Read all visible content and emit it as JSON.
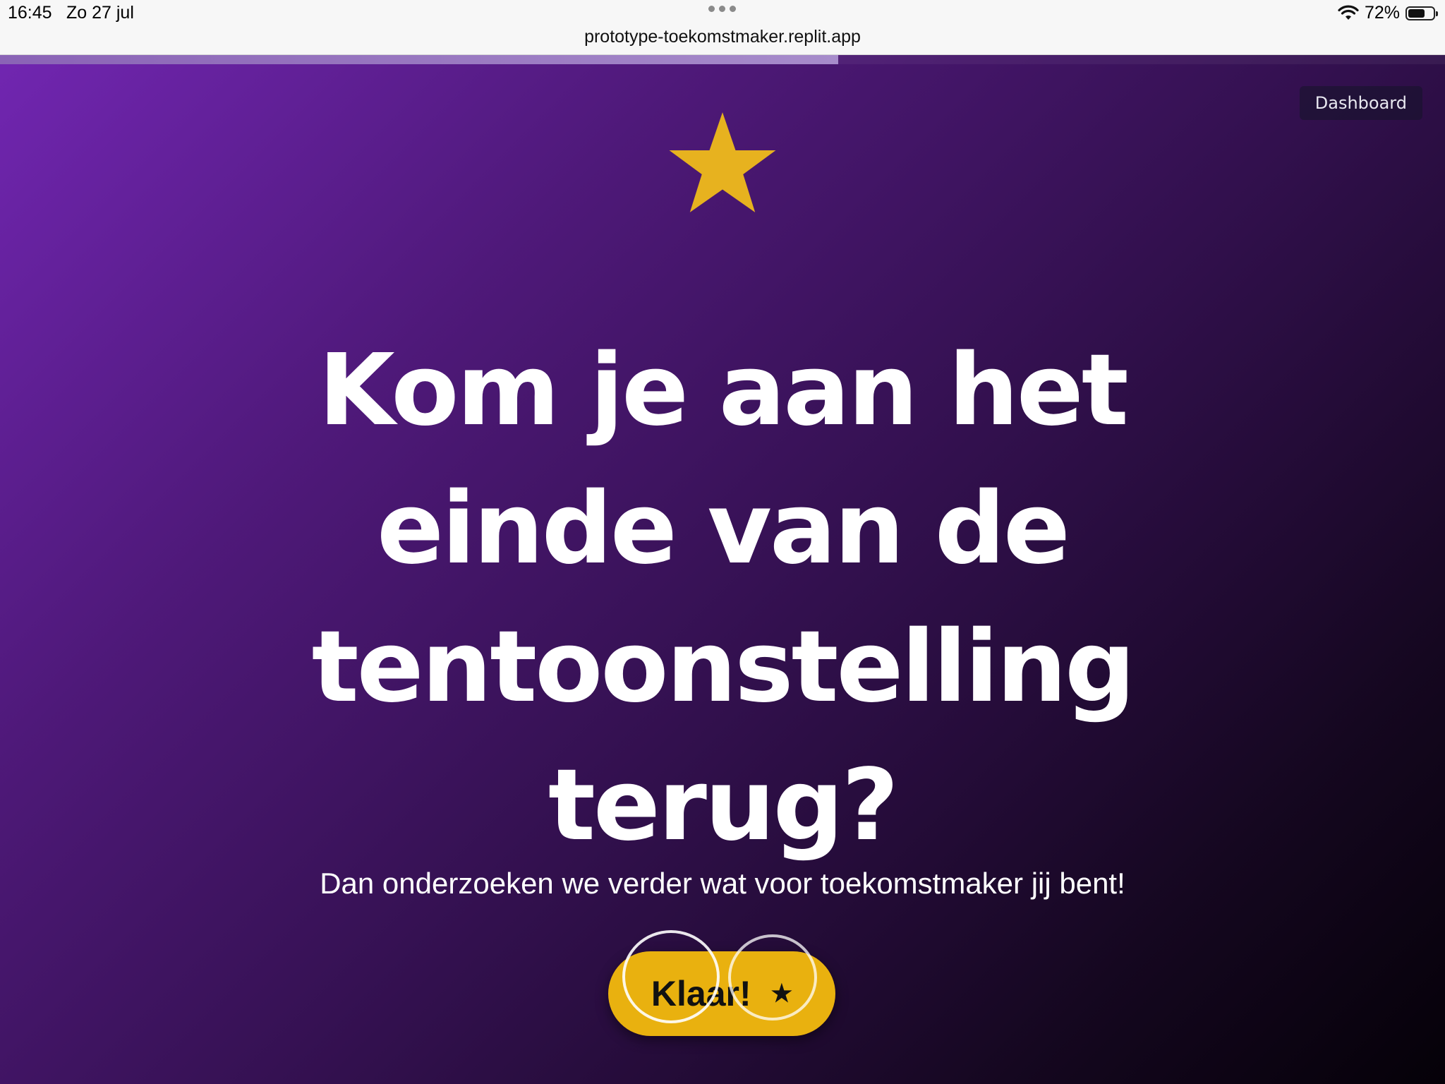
{
  "status_bar": {
    "time": "16:45",
    "date": "Zo 27 jul",
    "url": "prototype-toekomstmaker.replit.app",
    "battery": "72%",
    "battery_level": 0.72,
    "icons": [
      "more-dots-icon",
      "wifi-icon",
      "battery-icon"
    ]
  },
  "page": {
    "progress": 0.58,
    "dashboard_label": "Dashboard",
    "star_icon": "star-icon",
    "star_color": "#e7b21f",
    "background_top": "#7126b1",
    "background_bottom": "#050108",
    "headline": "Kom je aan het einde van de tentoonstelling terug?",
    "subline": "Dan onderzoeken we verder wat voor toekomstmaker jij bent!",
    "cta_label": "Klaar!",
    "cta_icon": "★",
    "cta_color": "#e9b10f"
  }
}
